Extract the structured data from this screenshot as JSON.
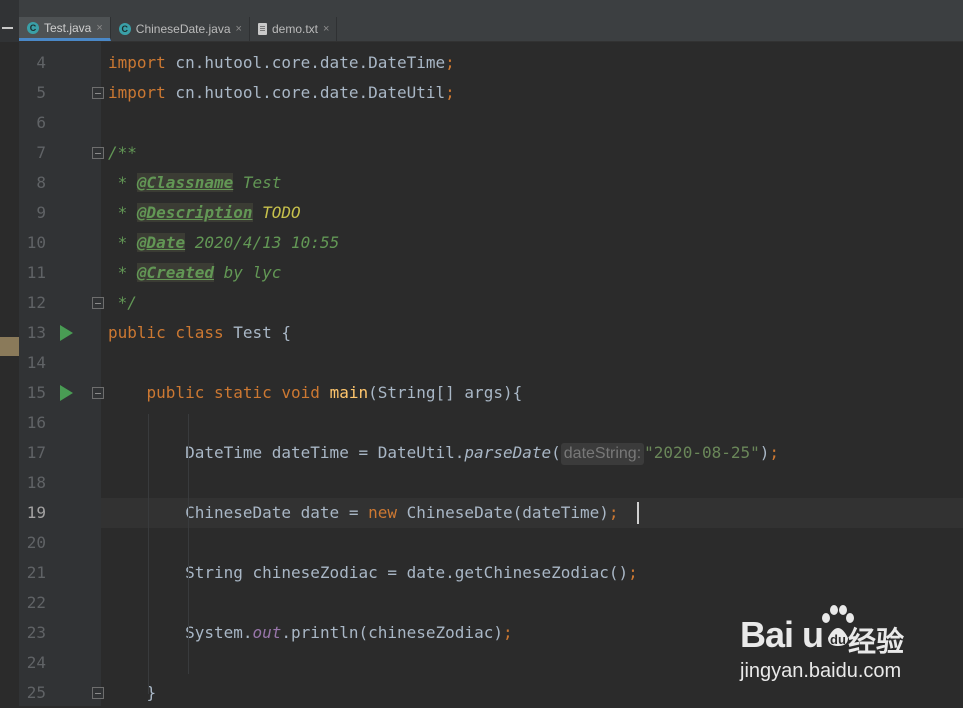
{
  "tabs": [
    {
      "label": "Test.java",
      "icon": "java-class-icon",
      "active": true
    },
    {
      "label": "ChineseDate.java",
      "icon": "java-class-icon",
      "active": false
    },
    {
      "label": "demo.txt",
      "icon": "text-file-icon",
      "active": false
    }
  ],
  "tab_close_glyph": "×",
  "editor": {
    "current_line": 19,
    "lines": [
      {
        "no": "4",
        "tokens": [
          [
            "kw",
            "import"
          ],
          [
            "plain",
            " cn.hutool.core.date.DateTime"
          ],
          [
            "kw",
            ";"
          ]
        ]
      },
      {
        "no": "5",
        "tokens": [
          [
            "kw",
            "import"
          ],
          [
            "plain",
            " cn.hutool.core.date.DateUtil"
          ],
          [
            "kw",
            ";"
          ]
        ]
      },
      {
        "no": "6",
        "tokens": []
      },
      {
        "no": "7",
        "tokens": [
          [
            "cmt",
            "/**"
          ]
        ]
      },
      {
        "no": "8",
        "tokens": [
          [
            "cmt",
            " * "
          ],
          [
            "tag",
            "@Classname"
          ],
          [
            "cmt",
            " Test"
          ]
        ]
      },
      {
        "no": "9",
        "tokens": [
          [
            "cmt",
            " * "
          ],
          [
            "tag",
            "@Description"
          ],
          [
            "cmt",
            " "
          ],
          [
            "todo",
            "TODO"
          ]
        ]
      },
      {
        "no": "10",
        "tokens": [
          [
            "cmt",
            " * "
          ],
          [
            "tag",
            "@Date"
          ],
          [
            "cmt",
            " 2020/4/13 10:55"
          ]
        ]
      },
      {
        "no": "11",
        "tokens": [
          [
            "cmt",
            " * "
          ],
          [
            "tag",
            "@Created"
          ],
          [
            "cmt",
            " by lyc"
          ]
        ]
      },
      {
        "no": "12",
        "tokens": [
          [
            "cmt",
            " */"
          ]
        ]
      },
      {
        "no": "13",
        "tokens": [
          [
            "kw",
            "public class"
          ],
          [
            "plain",
            " Test {"
          ]
        ]
      },
      {
        "no": "14",
        "tokens": []
      },
      {
        "no": "15",
        "tokens": [
          [
            "plain",
            "    "
          ],
          [
            "kw",
            "public static void"
          ],
          [
            "plain",
            " "
          ],
          [
            "fn",
            "main"
          ],
          [
            "plain",
            "(String[] args){"
          ]
        ]
      },
      {
        "no": "16",
        "tokens": []
      },
      {
        "no": "17",
        "tokens": [
          [
            "plain",
            "        DateTime dateTime = DateUtil."
          ],
          [
            "ital",
            "parseDate"
          ],
          [
            "plain",
            "("
          ],
          [
            "hint",
            "dateString:"
          ],
          [
            "str",
            "\"2020-08-25\""
          ],
          [
            "plain",
            ")"
          ],
          [
            "kw",
            ";"
          ]
        ]
      },
      {
        "no": "18",
        "tokens": []
      },
      {
        "no": "19",
        "tokens": [
          [
            "plain",
            "        ChineseDate date = "
          ],
          [
            "kw",
            "new"
          ],
          [
            "plain",
            " ChineseDate(dateTime)"
          ],
          [
            "kw",
            ";"
          ]
        ]
      },
      {
        "no": "20",
        "tokens": []
      },
      {
        "no": "21",
        "tokens": [
          [
            "plain",
            "        String chineseZodiac = date.getChineseZodiac()"
          ],
          [
            "kw",
            ";"
          ]
        ]
      },
      {
        "no": "22",
        "tokens": []
      },
      {
        "no": "23",
        "tokens": [
          [
            "plain",
            "        System."
          ],
          [
            "fld",
            "out"
          ],
          [
            "plain",
            ".println(chineseZodiac)"
          ],
          [
            "kw",
            ";"
          ]
        ]
      },
      {
        "no": "24",
        "tokens": []
      },
      {
        "no": "25",
        "tokens": [
          [
            "plain",
            "    }"
          ]
        ]
      }
    ]
  },
  "watermark": {
    "brand": "Bai  u",
    "cn": "经验",
    "url": "jingyan.baidu.com"
  },
  "colors": {
    "background": "#2b2b2b",
    "gutter": "#313335",
    "keyword": "#cc7832",
    "comment": "#629755",
    "string": "#6a8759",
    "function": "#ffc66d",
    "field": "#9876aa",
    "run_gutter": "#499c54",
    "tab_accent": "#4a88c7"
  }
}
